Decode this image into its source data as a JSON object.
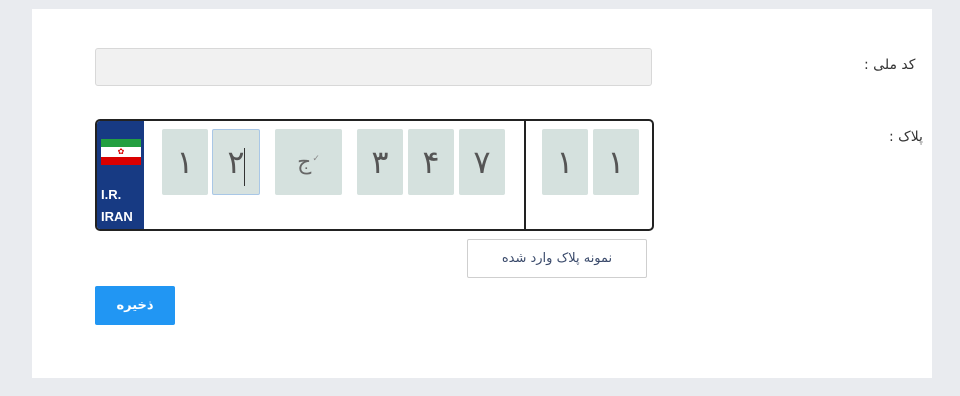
{
  "form": {
    "national_code_label": "کد ملی :",
    "national_code_value": "",
    "plate_label": "پلاک :",
    "sample_button_label": "نمونه پلاک وارد شده",
    "save_button_label": "ذخیره"
  },
  "plate": {
    "strip_line1": "I.R.",
    "strip_line2": "IRAN",
    "digits_left": [
      "۱",
      "۲"
    ],
    "letter": "ج",
    "digits_middle": [
      "۳",
      "۴",
      "۷"
    ],
    "region_digits": [
      "۱",
      "۱"
    ]
  },
  "colors": {
    "accent": "#2196f3",
    "plate_strip": "#173a83",
    "slot_bg": "#d5e1de"
  },
  "icons": {
    "letter_dropdown": "chevron-down-icon",
    "flag": "iran-flag-icon"
  }
}
